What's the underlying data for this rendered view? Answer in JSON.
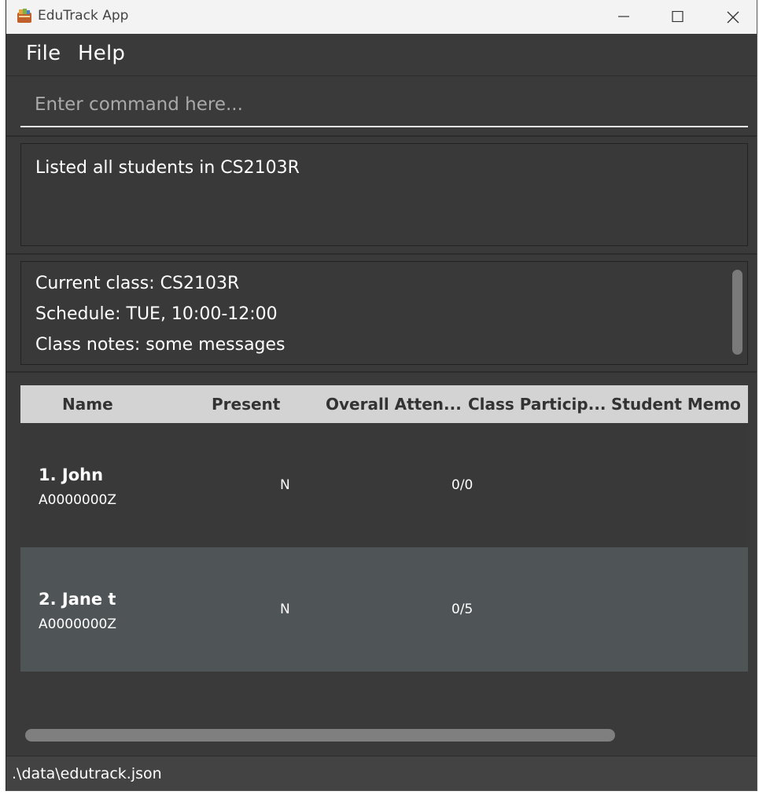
{
  "window": {
    "title": "EduTrack App",
    "controls": [
      "minimize-icon",
      "maximize-icon",
      "close-icon"
    ]
  },
  "menu": {
    "items": [
      {
        "label": "File"
      },
      {
        "label": "Help"
      }
    ]
  },
  "command": {
    "value": "",
    "placeholder": "Enter command here..."
  },
  "result": {
    "message": "Listed all students in CS2103R"
  },
  "class_info": {
    "current_class": "Current class: CS2103R",
    "schedule": "Schedule: TUE, 10:00-12:00",
    "notes": "Class notes: some messages"
  },
  "table": {
    "columns": [
      "Name",
      "Present",
      "Overall Atten...",
      "Class Particip...",
      "Student Memo"
    ],
    "rows": [
      {
        "name": "1.  John",
        "id": "A0000000Z",
        "present": "N",
        "overall_attendance": "",
        "participation": "0/0",
        "memo": "",
        "highlighted": false
      },
      {
        "name": "2.  Jane t",
        "id": "A0000000Z",
        "present": "N",
        "overall_attendance": "",
        "participation": "0/5",
        "memo": "",
        "highlighted": true
      }
    ]
  },
  "status": {
    "file_path": ".\\data\\edutrack.json"
  },
  "colors": {
    "background": "#3a3a3a",
    "header": "#d3d3d3",
    "row_highlight": "#4f5457",
    "row_default": "#393939"
  }
}
